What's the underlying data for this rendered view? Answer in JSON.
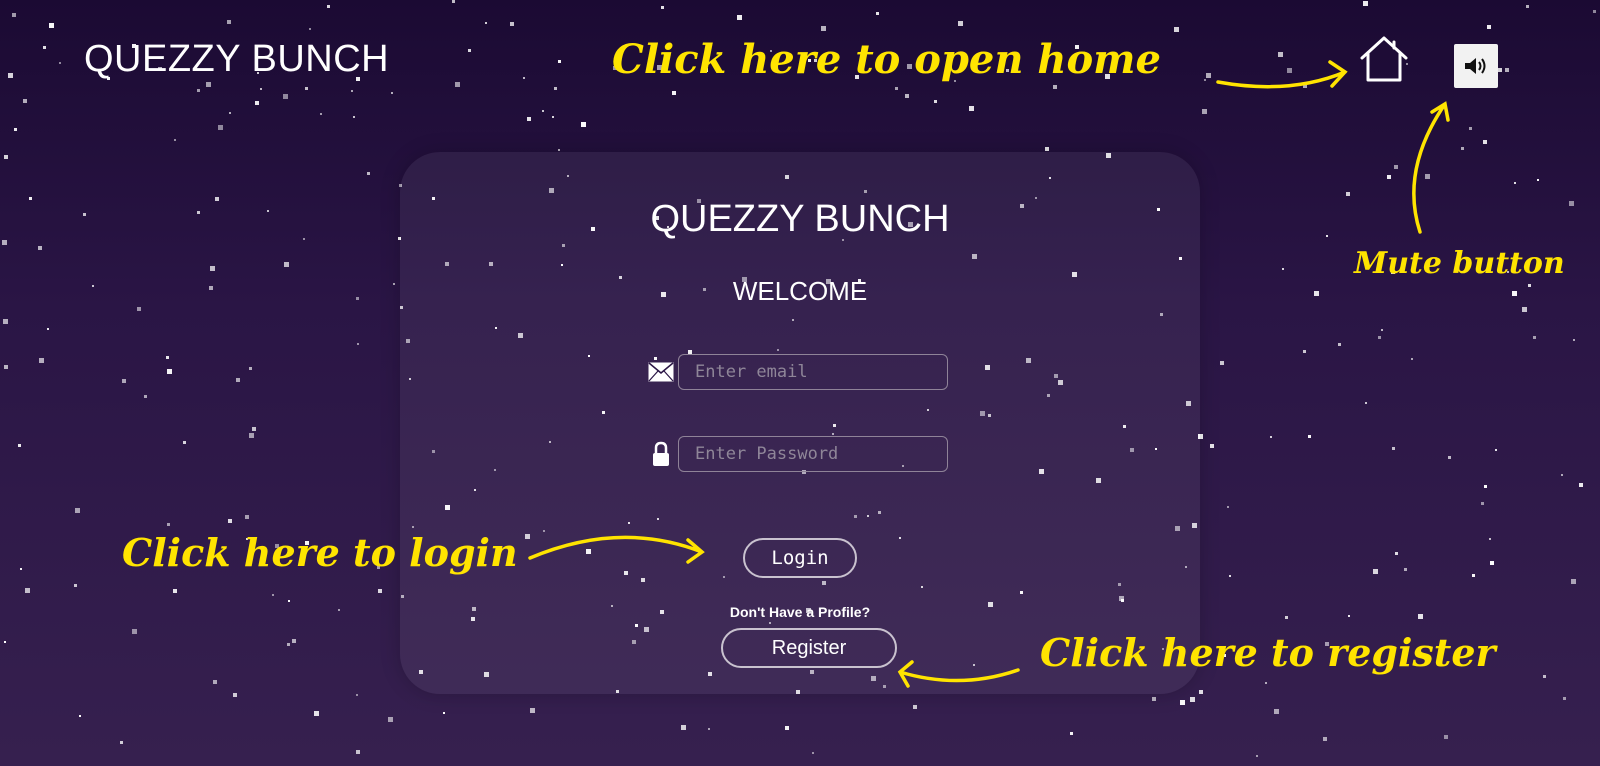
{
  "header": {
    "brand": "QUEZZY BUNCH",
    "home_icon": "home-icon",
    "mute_icon": "speaker-volume-icon"
  },
  "login_card": {
    "title": "QUEZZY BUNCH",
    "subtitle": "WELCOME",
    "email": {
      "icon": "envelope-icon",
      "placeholder": "Enter email",
      "value": ""
    },
    "password": {
      "icon": "lock-icon",
      "placeholder": "Enter Password",
      "value": ""
    },
    "login_label": "Login",
    "profile_prompt": "Don't Have a Profile?",
    "register_label": "Register"
  },
  "annotations": {
    "home": "Click here to open home",
    "mute": "Mute button",
    "login": "Click here to login",
    "register": "Click here to register"
  },
  "colors": {
    "background_top": "#1b0a33",
    "background_bottom": "#36204f",
    "annotation": "#ffe400",
    "card": "rgba(255,255,255,0.06)"
  }
}
